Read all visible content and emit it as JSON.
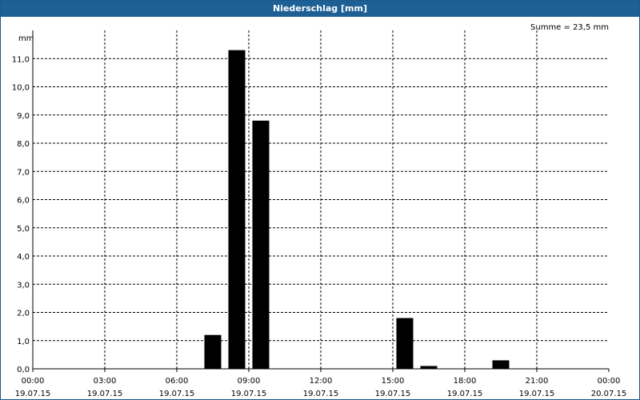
{
  "window": {
    "title": "Niederschlag [mm]"
  },
  "chart_data": {
    "type": "bar",
    "ylabel": "mm",
    "ylim": [
      0,
      12
    ],
    "xlim_hours": [
      0,
      24
    ],
    "annotation": "Summe = 23,5 mm",
    "y_ticks": [
      "0,0",
      "1,0",
      "2,0",
      "3,0",
      "4,0",
      "5,0",
      "6,0",
      "7,0",
      "8,0",
      "9,0",
      "10,0",
      "11,0"
    ],
    "x_ticks": [
      {
        "time": "00:00",
        "date": "19.07.15"
      },
      {
        "time": "03:00",
        "date": "19.07.15"
      },
      {
        "time": "06:00",
        "date": "19.07.15"
      },
      {
        "time": "09:00",
        "date": "19.07.15"
      },
      {
        "time": "12:00",
        "date": "19.07.15"
      },
      {
        "time": "15:00",
        "date": "19.07.15"
      },
      {
        "time": "18:00",
        "date": "19.07.15"
      },
      {
        "time": "21:00",
        "date": "19.07.15"
      },
      {
        "time": "00:00",
        "date": "20.07.15"
      }
    ],
    "bars": [
      {
        "hour": 7.5,
        "value": 1.2
      },
      {
        "hour": 8.5,
        "value": 11.3
      },
      {
        "hour": 9.5,
        "value": 8.8
      },
      {
        "hour": 15.5,
        "value": 1.8
      },
      {
        "hour": 16.5,
        "value": 0.1
      },
      {
        "hour": 19.5,
        "value": 0.3
      }
    ],
    "bar_color": "#000000",
    "grid": true
  }
}
